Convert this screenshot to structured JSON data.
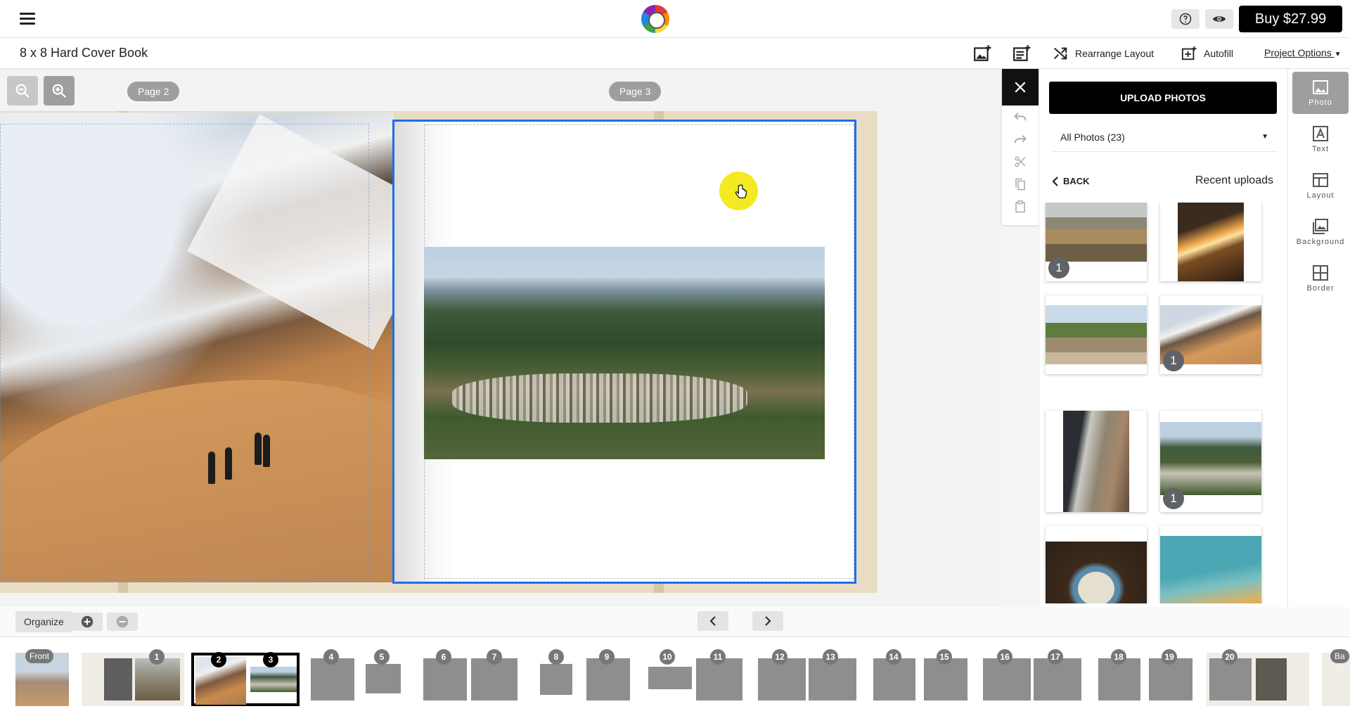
{
  "header": {
    "buy_label": "Buy $27.99",
    "help_icon": "question-circle-icon",
    "preview_icon": "eye-icon",
    "menu_icon": "hamburger-icon"
  },
  "toolbar": {
    "project_title": "8 x 8 Hard Cover Book",
    "add_photo_page_icon": "add-photo-icon",
    "add_text_page_icon": "add-page-icon",
    "rearrange_label": "Rearrange Layout",
    "autofill_label": "Autofill",
    "project_options_label": "Project Options"
  },
  "canvas": {
    "left_page_label": "Page 2",
    "right_page_label": "Page 3"
  },
  "panel": {
    "upload_label": "UPLOAD PHOTOS",
    "photo_filter": "All Photos (23)",
    "back_label": "BACK",
    "recent_label": "Recent uploads",
    "thumbnails": [
      {
        "badge": "1"
      },
      {
        "badge": ""
      },
      {
        "badge": ""
      },
      {
        "badge": "1"
      },
      {
        "badge": ""
      },
      {
        "badge": "1"
      },
      {
        "badge": ""
      },
      {
        "badge": ""
      }
    ]
  },
  "sidetabs": {
    "photo": "Photo",
    "text": "Text",
    "layout": "Layout",
    "background": "Background",
    "border": "Border"
  },
  "bottom": {
    "organize_label": "Organize",
    "front_label": "Front",
    "back_cover_label": "Ba",
    "pages": [
      "1",
      "2",
      "3",
      "4",
      "5",
      "6",
      "7",
      "8",
      "9",
      "10",
      "11",
      "12",
      "13",
      "14",
      "15",
      "16",
      "17",
      "18",
      "19",
      "20"
    ]
  },
  "colors": {
    "accent": "#1e6fe6",
    "cursor_highlight": "#f4ea21",
    "primary_button": "#000000"
  }
}
